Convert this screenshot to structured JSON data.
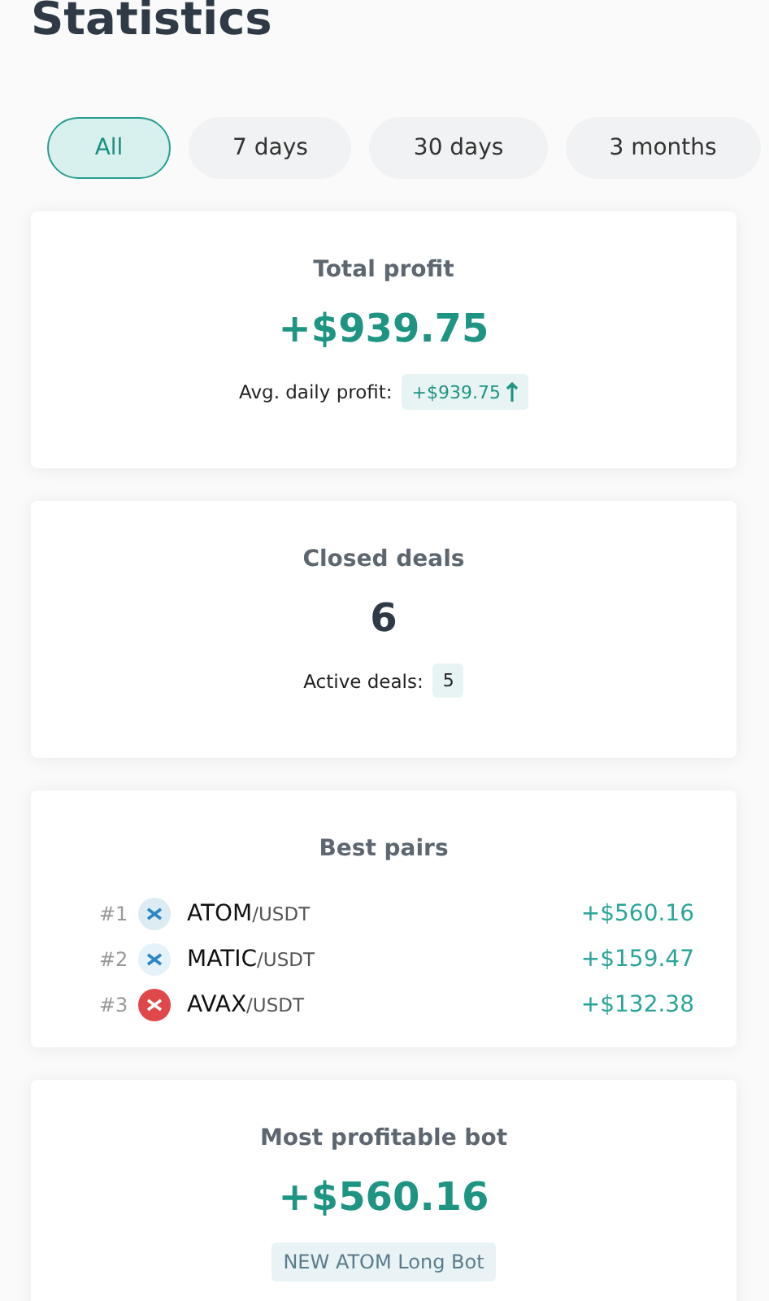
{
  "title": "Statistics",
  "tabs": [
    {
      "label": "All",
      "selected": true
    },
    {
      "label": "7 days",
      "selected": false
    },
    {
      "label": "30 days",
      "selected": false
    },
    {
      "label": "3 months",
      "selected": false
    }
  ],
  "total_profit": {
    "title": "Total profit",
    "value": "+$939.75",
    "avg_label": "Avg. daily profit:",
    "avg_value": "+$939.75"
  },
  "closed_deals": {
    "title": "Closed deals",
    "value": "6",
    "active_label": "Active deals:",
    "active_value": "5"
  },
  "best_pairs": {
    "title": "Best pairs",
    "pairs": [
      {
        "rank": "#1",
        "base": "ATOM",
        "quote": "/USDT",
        "profit": "+$560.16",
        "color": "#dcecf2"
      },
      {
        "rank": "#2",
        "base": "MATIC",
        "quote": "/USDT",
        "profit": "+$159.47",
        "color": "#e6f2fa"
      },
      {
        "rank": "#3",
        "base": "AVAX",
        "quote": "/USDT",
        "profit": "+$132.38",
        "color": "#e0474b"
      }
    ]
  },
  "best_bot": {
    "title": "Most profitable bot",
    "value": "+$560.16",
    "bot_name": "NEW ATOM Long Bot"
  }
}
